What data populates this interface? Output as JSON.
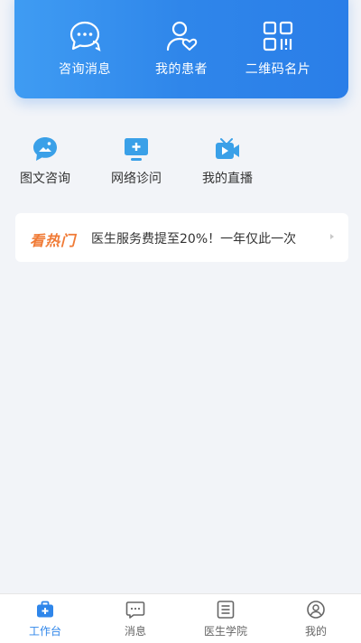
{
  "top_actions": [
    {
      "label": "咨询消息",
      "icon": "chat-bubble-icon"
    },
    {
      "label": "我的患者",
      "icon": "patient-heart-icon"
    },
    {
      "label": "二维码名片",
      "icon": "qr-code-icon"
    }
  ],
  "services": [
    {
      "label": "图文咨询",
      "icon": "image-chat-icon"
    },
    {
      "label": "网络诊问",
      "icon": "online-clinic-icon"
    },
    {
      "label": "我的直播",
      "icon": "live-video-icon"
    }
  ],
  "hot": {
    "tag": "看热门",
    "text": "医生服务费提至20%！一年仅此一次",
    "arrow_icon": "chevron-right-icon"
  },
  "tabbar": [
    {
      "label": "工作台",
      "icon": "medical-kit-icon",
      "active": true
    },
    {
      "label": "消息",
      "icon": "message-icon",
      "active": false
    },
    {
      "label": "医生学院",
      "icon": "document-list-icon",
      "active": false
    },
    {
      "label": "我的",
      "icon": "user-circle-icon",
      "active": false
    }
  ],
  "colors": {
    "accent": "#2f86ea",
    "hot_tag": "#f07a35",
    "service_icon": "#3aa0e8"
  }
}
